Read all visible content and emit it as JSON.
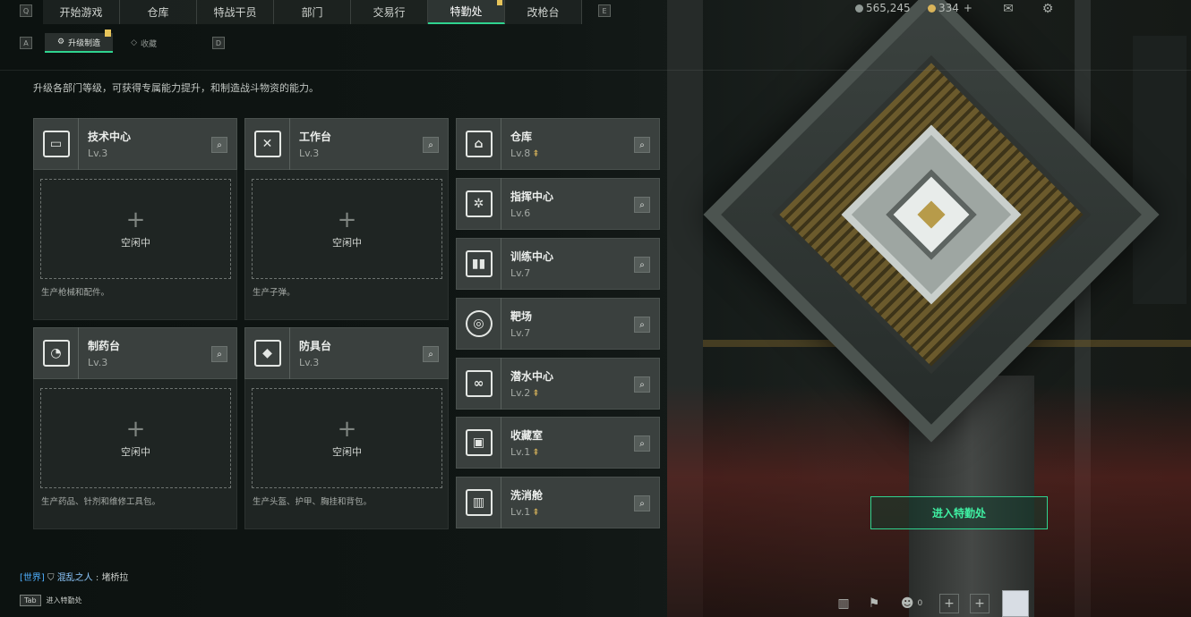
{
  "nav": {
    "left_key": "Q",
    "right_key": "E",
    "tabs": [
      {
        "label": "开始游戏"
      },
      {
        "label": "仓库"
      },
      {
        "label": "特战干员"
      },
      {
        "label": "部门"
      },
      {
        "label": "交易行"
      },
      {
        "label": "特勤处",
        "active": true
      },
      {
        "label": "改枪台"
      }
    ],
    "currency1": "565,245",
    "currency2": "334",
    "plus": "+"
  },
  "subtabs": {
    "left_key": "A",
    "right_key": "D",
    "items": [
      {
        "label": "升级制造",
        "active": true
      },
      {
        "label": "收藏"
      }
    ]
  },
  "description": "升级各部门等级，可获得专属能力提升，和制造战斗物资的能力。",
  "workshops": [
    {
      "title": "技术中心",
      "level": "Lv.3",
      "icon": "monitor-icon",
      "slot": "空闲中",
      "note": "生产枪械和配件。"
    },
    {
      "title": "工作台",
      "level": "Lv.3",
      "icon": "tools-icon",
      "slot": "空闲中",
      "note": "生产子弹。"
    },
    {
      "title": "制药台",
      "level": "Lv.3",
      "icon": "microscope-icon",
      "slot": "空闲中",
      "note": "生产药品、针剂和维修工具包。"
    },
    {
      "title": "防具台",
      "level": "Lv.3",
      "icon": "cubes-icon",
      "slot": "空闲中",
      "note": "生产头盔、护甲、胸挂和背包。"
    }
  ],
  "facilities": [
    {
      "title": "仓库",
      "level": "Lv.8",
      "up": true,
      "icon": "warehouse-icon"
    },
    {
      "title": "指挥中心",
      "level": "Lv.6",
      "up": false,
      "icon": "command-icon"
    },
    {
      "title": "训练中心",
      "level": "Lv.7",
      "up": false,
      "icon": "dumbbell-icon"
    },
    {
      "title": "靶场",
      "level": "Lv.7",
      "up": false,
      "icon": "target-icon"
    },
    {
      "title": "潜水中心",
      "level": "Lv.2",
      "up": true,
      "icon": "diving-icon"
    },
    {
      "title": "收藏室",
      "level": "Lv.1",
      "up": true,
      "icon": "collection-icon"
    },
    {
      "title": "洗消舱",
      "level": "Lv.1",
      "up": true,
      "icon": "decon-icon"
    }
  ],
  "enter_button": "进入特勤处",
  "chat": {
    "channel": "[世界]",
    "name": "混乱之人",
    "message": "堵桥拉"
  },
  "tab_hint": {
    "key": "Tab",
    "label": "进入特勤处"
  },
  "bottom": {
    "friends_count": "0"
  }
}
